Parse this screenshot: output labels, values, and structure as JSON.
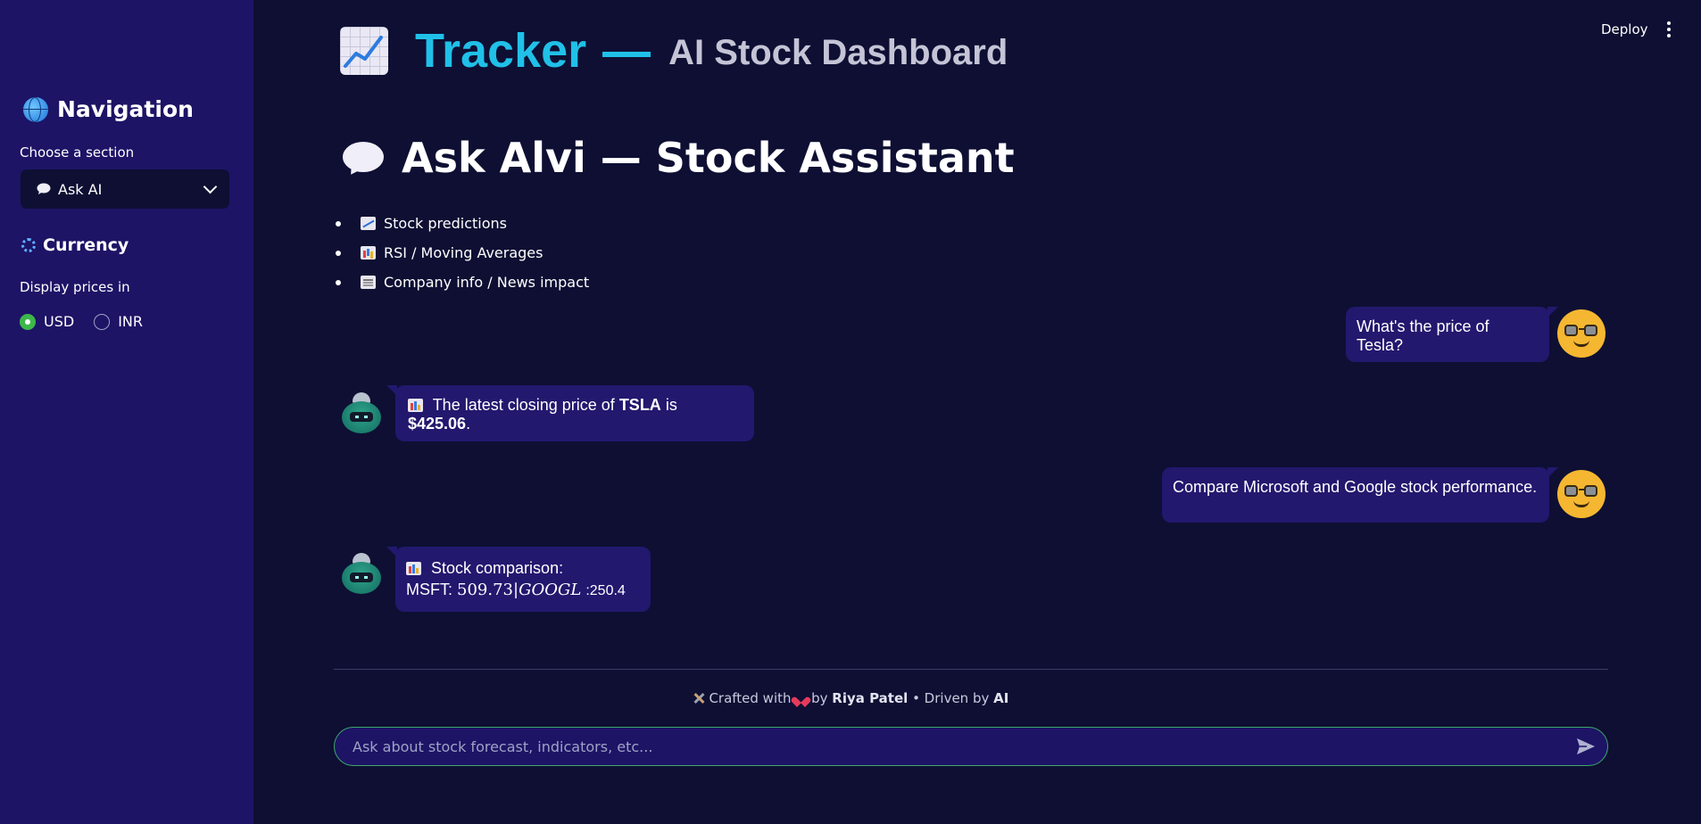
{
  "sidebar": {
    "nav_title": "Navigation",
    "section_label": "Choose a section",
    "section_select": {
      "icon": "speech-bubble-icon",
      "value": "Ask AI"
    },
    "currency_title": "Currency",
    "display_label": "Display prices in",
    "currency_options": [
      {
        "label": "USD",
        "selected": true
      },
      {
        "label": "INR",
        "selected": false
      }
    ]
  },
  "header": {
    "deploy_label": "Deploy",
    "app_name": "Tracker",
    "app_subtitle": "AI Stock Dashboard"
  },
  "main": {
    "page_title": "Ask Alvi — Stock Assistant",
    "features": [
      {
        "icon": "chart-increasing-icon",
        "label": "Stock predictions"
      },
      {
        "icon": "bar-chart-icon",
        "label": "RSI / Moving Averages"
      },
      {
        "icon": "newspaper-icon",
        "label": "Company info / News impact"
      }
    ],
    "chat": {
      "msg1_user": "What's the price of Tesla?",
      "msg2_bot_pre": "The latest closing price of",
      "msg2_bot_ticker": "TSLA",
      "msg2_bot_mid": "is",
      "msg2_bot_price": "$425.06",
      "msg2_bot_end": ".",
      "msg3_user": "Compare Microsoft and Google stock performance.",
      "msg4_bot_line1": "Stock comparison:",
      "msg4_bot_msft_label": "MSFT:",
      "msg4_bot_msft_value": "509.73",
      "msg4_bot_googl_label": "GOOGL",
      "msg4_bot_googl_value": ":250.4"
    },
    "footer": {
      "crafted_with": "Crafted with",
      "by": "by",
      "author": "Riya Patel",
      "driven_by": "• Driven by",
      "ai": "AI"
    },
    "chat_input": {
      "placeholder": "Ask about stock forecast, indicators, etc..."
    }
  },
  "colors": {
    "sidebar_bg": "#1d1466",
    "main_bg": "#0e0f33",
    "accent_cyan": "#20c0e8",
    "bubble_bg": "#22186e",
    "radio_on": "#3cb84a",
    "input_border": "#3ca86a"
  }
}
